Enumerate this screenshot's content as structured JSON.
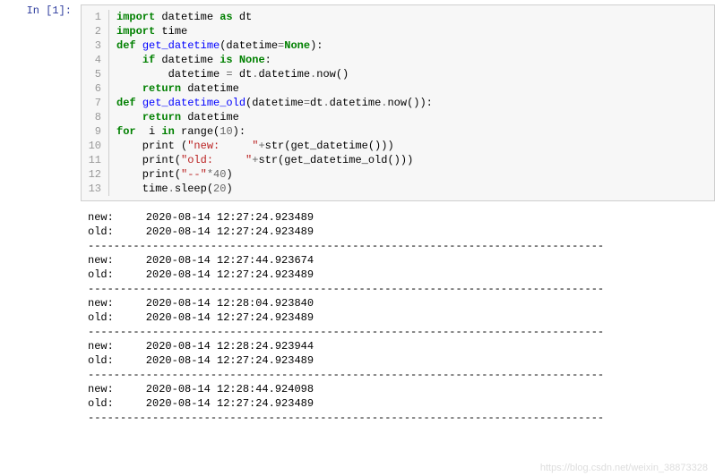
{
  "prompt": {
    "label": "In [1]:"
  },
  "code": {
    "lines": [
      {
        "n": "1",
        "tokens": [
          {
            "t": "import",
            "c": "k"
          },
          {
            "t": " datetime ",
            "c": ""
          },
          {
            "t": "as",
            "c": "k"
          },
          {
            "t": " dt",
            "c": ""
          }
        ]
      },
      {
        "n": "2",
        "tokens": [
          {
            "t": "import",
            "c": "k"
          },
          {
            "t": " time",
            "c": ""
          }
        ]
      },
      {
        "n": "3",
        "tokens": [
          {
            "t": "def",
            "c": "k"
          },
          {
            "t": " ",
            "c": ""
          },
          {
            "t": "get_datetime",
            "c": "nf"
          },
          {
            "t": "(datetime",
            "c": ""
          },
          {
            "t": "=",
            "c": "o"
          },
          {
            "t": "None",
            "c": "k"
          },
          {
            "t": "):",
            "c": ""
          }
        ]
      },
      {
        "n": "4",
        "tokens": [
          {
            "t": "    ",
            "c": ""
          },
          {
            "t": "if",
            "c": "k"
          },
          {
            "t": " datetime ",
            "c": ""
          },
          {
            "t": "is",
            "c": "k"
          },
          {
            "t": " ",
            "c": ""
          },
          {
            "t": "None",
            "c": "k"
          },
          {
            "t": ":",
            "c": ""
          }
        ]
      },
      {
        "n": "5",
        "tokens": [
          {
            "t": "        datetime ",
            "c": ""
          },
          {
            "t": "=",
            "c": "o"
          },
          {
            "t": " dt",
            "c": ""
          },
          {
            "t": ".",
            "c": "o"
          },
          {
            "t": "datetime",
            "c": ""
          },
          {
            "t": ".",
            "c": "o"
          },
          {
            "t": "now()",
            "c": ""
          }
        ]
      },
      {
        "n": "6",
        "tokens": [
          {
            "t": "    ",
            "c": ""
          },
          {
            "t": "return",
            "c": "k"
          },
          {
            "t": " datetime",
            "c": ""
          }
        ]
      },
      {
        "n": "7",
        "tokens": [
          {
            "t": "def",
            "c": "k"
          },
          {
            "t": " ",
            "c": ""
          },
          {
            "t": "get_datetime_old",
            "c": "nf"
          },
          {
            "t": "(datetime",
            "c": ""
          },
          {
            "t": "=",
            "c": "o"
          },
          {
            "t": "dt",
            "c": ""
          },
          {
            "t": ".",
            "c": "o"
          },
          {
            "t": "datetime",
            "c": ""
          },
          {
            "t": ".",
            "c": "o"
          },
          {
            "t": "now()):",
            "c": ""
          }
        ]
      },
      {
        "n": "8",
        "tokens": [
          {
            "t": "    ",
            "c": ""
          },
          {
            "t": "return",
            "c": "k"
          },
          {
            "t": " datetime",
            "c": ""
          }
        ]
      },
      {
        "n": "9",
        "tokens": [
          {
            "t": "for",
            "c": "k"
          },
          {
            "t": "  i ",
            "c": ""
          },
          {
            "t": "in",
            "c": "k"
          },
          {
            "t": " range(",
            "c": ""
          },
          {
            "t": "10",
            "c": "mi"
          },
          {
            "t": "):",
            "c": ""
          }
        ]
      },
      {
        "n": "10",
        "tokens": [
          {
            "t": "    print (",
            "c": ""
          },
          {
            "t": "\"new:     \"",
            "c": "s"
          },
          {
            "t": "+",
            "c": "o"
          },
          {
            "t": "str(get_datetime()))",
            "c": ""
          }
        ]
      },
      {
        "n": "11",
        "tokens": [
          {
            "t": "    print(",
            "c": ""
          },
          {
            "t": "\"old:     \"",
            "c": "s"
          },
          {
            "t": "+",
            "c": "o"
          },
          {
            "t": "str(get_datetime_old()))",
            "c": ""
          }
        ]
      },
      {
        "n": "12",
        "tokens": [
          {
            "t": "    print(",
            "c": ""
          },
          {
            "t": "\"--\"",
            "c": "s"
          },
          {
            "t": "*",
            "c": "o"
          },
          {
            "t": "40",
            "c": "mi"
          },
          {
            "t": ")",
            "c": ""
          }
        ]
      },
      {
        "n": "13",
        "tokens": [
          {
            "t": "    time",
            "c": ""
          },
          {
            "t": ".",
            "c": "o"
          },
          {
            "t": "sleep(",
            "c": ""
          },
          {
            "t": "20",
            "c": "mi"
          },
          {
            "t": ")",
            "c": ""
          }
        ]
      }
    ]
  },
  "output": {
    "separator": "--------------------------------------------------------------------------------",
    "blocks": [
      {
        "new": "new:     2020-08-14 12:27:24.923489",
        "old": "old:     2020-08-14 12:27:24.923489"
      },
      {
        "new": "new:     2020-08-14 12:27:44.923674",
        "old": "old:     2020-08-14 12:27:24.923489"
      },
      {
        "new": "new:     2020-08-14 12:28:04.923840",
        "old": "old:     2020-08-14 12:27:24.923489"
      },
      {
        "new": "new:     2020-08-14 12:28:24.923944",
        "old": "old:     2020-08-14 12:27:24.923489"
      },
      {
        "new": "new:     2020-08-14 12:28:44.924098",
        "old": "old:     2020-08-14 12:27:24.923489"
      }
    ]
  },
  "watermark": "https://blog.csdn.net/weixin_38873328"
}
